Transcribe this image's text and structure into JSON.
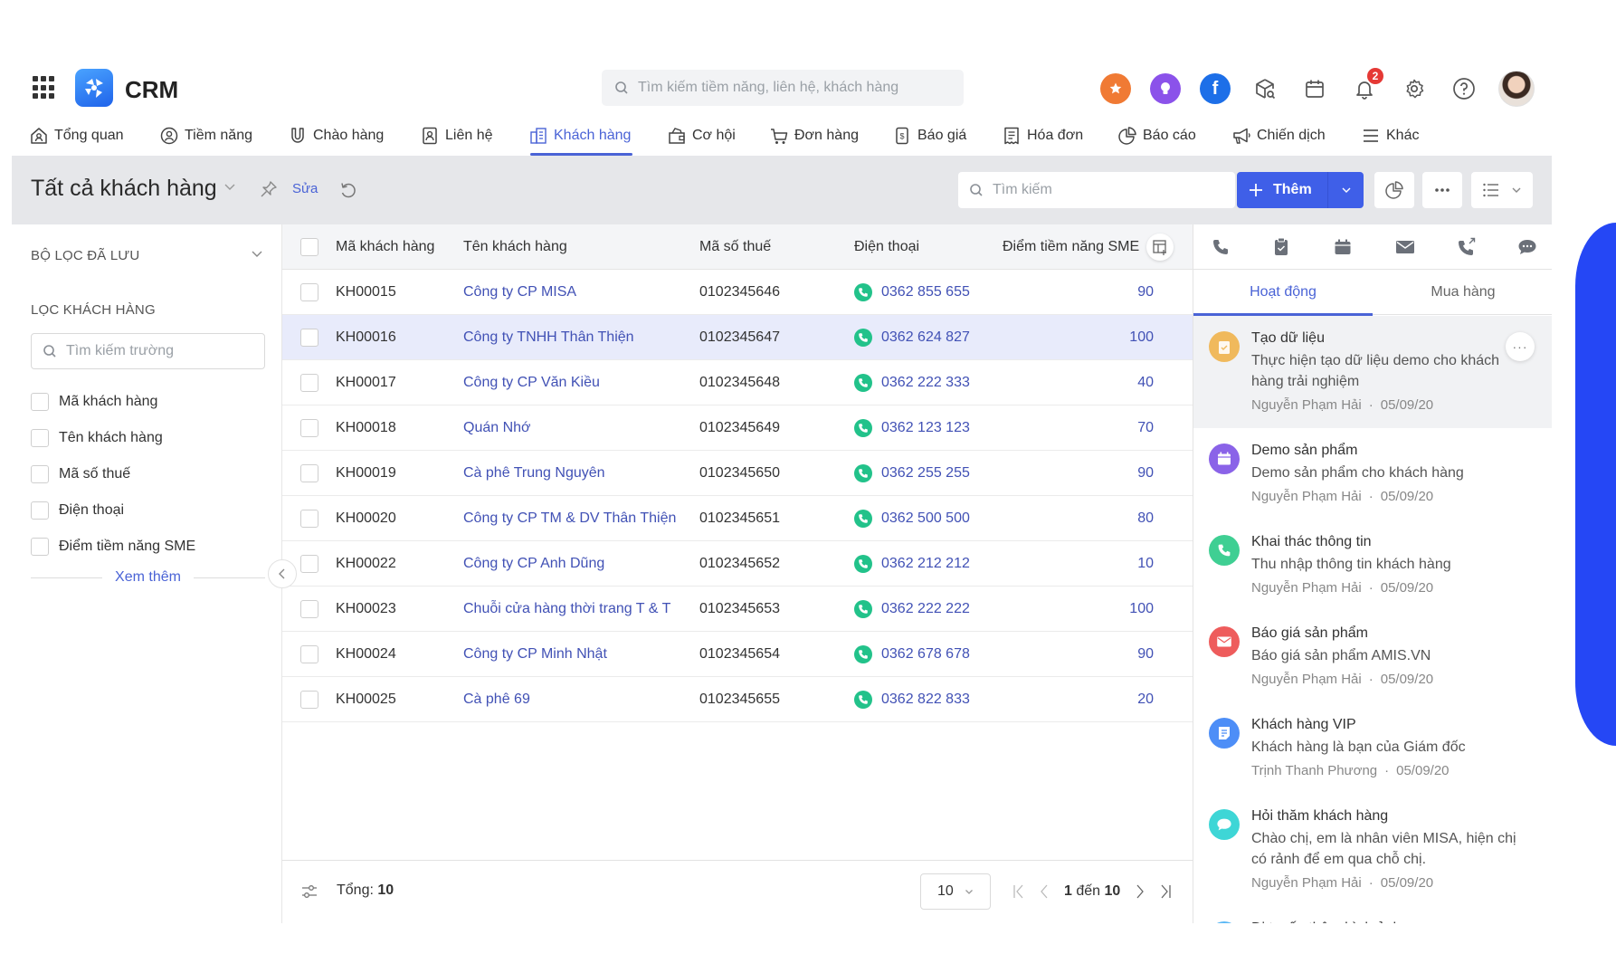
{
  "app": {
    "brand": "CRM",
    "global_search_placeholder": "Tìm kiếm tiềm năng, liên hệ, khách hàng",
    "notification_count": "2",
    "header_icons": [
      "star-icon",
      "lightbulb-icon",
      "facebook-icon",
      "package-search-icon",
      "calendar-icon",
      "bell-icon",
      "gear-icon",
      "help-icon",
      "avatar"
    ]
  },
  "nav": {
    "items": [
      {
        "label": "Tổng quan",
        "icon": "home-icon"
      },
      {
        "label": "Tiềm năng",
        "icon": "user-circle-icon"
      },
      {
        "label": "Chào hàng",
        "icon": "magnet-icon"
      },
      {
        "label": "Liên hệ",
        "icon": "contact-card-icon"
      },
      {
        "label": "Khách hàng",
        "icon": "building-icon",
        "active": true
      },
      {
        "label": "Cơ hội",
        "icon": "bag-icon"
      },
      {
        "label": "Đơn hàng",
        "icon": "cart-icon"
      },
      {
        "label": "Báo giá",
        "icon": "price-doc-icon"
      },
      {
        "label": "Hóa đơn",
        "icon": "receipt-icon"
      },
      {
        "label": "Báo cáo",
        "icon": "pie-chart-icon"
      },
      {
        "label": "Chiến dịch",
        "icon": "megaphone-icon"
      },
      {
        "label": "Khác",
        "icon": "menu-icon"
      }
    ]
  },
  "toolbar": {
    "title": "Tất cả khách hàng",
    "edit_label": "Sửa",
    "search_placeholder": "Tìm kiếm",
    "add_label": "Thêm"
  },
  "sidebar": {
    "saved_filters": "BỘ LỌC ĐÃ LƯU",
    "filter_heading": "LỌC KHÁCH HÀNG",
    "field_search_placeholder": "Tìm kiếm trường",
    "fields": [
      "Mã khách hàng",
      "Tên khách hàng",
      "Mã số thuế",
      "Điện thoại",
      "Điểm tiềm năng SME"
    ],
    "see_more": "Xem thêm"
  },
  "table": {
    "columns": [
      "Mã khách hàng",
      "Tên khách hàng",
      "Mã số thuế",
      "Điện thoại",
      "Điểm tiềm năng SME"
    ],
    "rows": [
      {
        "code": "KH00015",
        "name": "Công ty CP MISA",
        "tax": "0102345646",
        "phone": "0362 855 655",
        "score": "90"
      },
      {
        "code": "KH00016",
        "name": "Công ty TNHH Thân Thiện",
        "tax": "0102345647",
        "phone": "0362 624 827",
        "score": "100",
        "selected": true
      },
      {
        "code": "KH00017",
        "name": "Công ty CP Văn Kiều",
        "tax": "0102345648",
        "phone": "0362 222 333",
        "score": "40"
      },
      {
        "code": "KH00018",
        "name": "Quán Nhớ",
        "tax": "0102345649",
        "phone": "0362 123 123",
        "score": "70"
      },
      {
        "code": "KH00019",
        "name": "Cà phê Trung Nguyên",
        "tax": "0102345650",
        "phone": "0362 255 255",
        "score": "90"
      },
      {
        "code": "KH00020",
        "name": "Công ty CP TM & DV Thân Thiện",
        "tax": "0102345651",
        "phone": "0362 500 500",
        "score": "80"
      },
      {
        "code": "KH00022",
        "name": "Công ty CP Anh Dũng",
        "tax": "0102345652",
        "phone": "0362 212 212",
        "score": "10"
      },
      {
        "code": "KH00023",
        "name": "Chuỗi cửa hàng thời trang T & T",
        "tax": "0102345653",
        "phone": "0362 222 222",
        "score": "100"
      },
      {
        "code": "KH00024",
        "name": "Công ty CP Minh Nhật",
        "tax": "0102345654",
        "phone": "0362 678 678",
        "score": "90"
      },
      {
        "code": "KH00025",
        "name": "Cà phê 69",
        "tax": "0102345655",
        "phone": "0362 822 833",
        "score": "20"
      }
    ],
    "footer": {
      "total_label": "Tổng:",
      "total_value": "10",
      "page_size": "10",
      "range_start": "1",
      "range_word": "đến",
      "range_end": "10"
    }
  },
  "activity_panel": {
    "action_icons": [
      "phone-icon",
      "task-icon",
      "calendar-icon",
      "mail-icon",
      "outgoing-call-icon",
      "chat-icon"
    ],
    "tabs": [
      {
        "label": "Hoạt động",
        "active": true
      },
      {
        "label": "Mua hàng"
      }
    ],
    "items": [
      {
        "title": "Tạo dữ liệu",
        "desc": "Thực hiện tạo dữ liệu demo cho khách hàng trải nghiệm",
        "author": "Nguyễn Phạm Hải",
        "date": "05/09/20",
        "icon": "task-icon",
        "color": "#f0b95c",
        "highlight": true
      },
      {
        "title": "Demo sản phẩm",
        "desc": "Demo sản phẩm cho khách hàng",
        "author": "Nguyễn Phạm Hải",
        "date": "05/09/20",
        "icon": "calendar-icon",
        "color": "#8a63e8"
      },
      {
        "title": "Khai thác thông tin",
        "desc": "Thu nhập thông tin khách hàng",
        "author": "Nguyễn Phạm Hải",
        "date": "05/09/20",
        "icon": "phone-icon",
        "color": "#3fcf93"
      },
      {
        "title": "Báo giá sản phẩm",
        "desc": "Báo giá sản phẩm AMIS.VN",
        "author": "Nguyễn Phạm Hải",
        "date": "05/09/20",
        "icon": "mail-icon",
        "color": "#ee5c5c"
      },
      {
        "title": "Khách hàng VIP",
        "desc": "Khách hàng là bạn của Giám đốc",
        "author": "Trịnh Thanh Phương",
        "date": "05/09/20",
        "icon": "note-icon",
        "color": "#4d8ef7"
      },
      {
        "title": "Hỏi thăm khách hàng",
        "desc": "Chào chị, em là nhân viên MISA, hiện chị có rảnh để em qua chỗ chị.",
        "author": "Nguyễn Phạm Hải",
        "date": "05/09/20",
        "icon": "chat-icon",
        "color": "#3ed6d6"
      },
      {
        "title": "Đi tuyến thêm hình ảnh",
        "desc": "",
        "author": "",
        "date": "",
        "icon": "image-icon",
        "color": "#5bb8f5"
      }
    ]
  },
  "colors": {
    "accent": "#4a63d6",
    "primary_button": "#3f5fe8",
    "link": "#4151b5",
    "phone_green": "#22c28a",
    "selected_row": "#e8ebfb",
    "toolbar_bg": "#e6e7ea",
    "decor_blue": "#2547f5"
  }
}
